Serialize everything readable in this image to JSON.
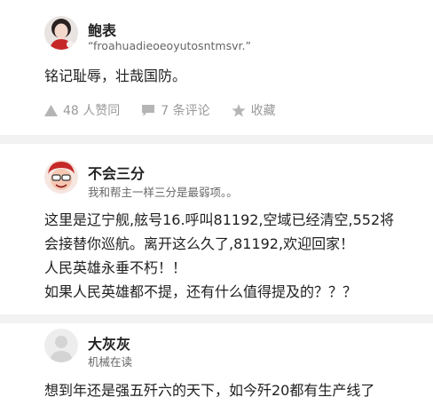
{
  "post": {
    "user": {
      "name": "鲍表",
      "subtitle": "“froahuadieoeoyutosntmsvr.”"
    },
    "text": "铭记耻辱，壮哉国防。",
    "actions": {
      "likes": "48 人赞同",
      "comments": "7 条评论",
      "favorite": "收藏"
    }
  },
  "comments": [
    {
      "name": "不会三分",
      "subtitle": "我和帮主一样三分是最弱项。。",
      "lines": [
        "这里是辽宁舰,舷号16.呼叫81192,空域已经清空,552将",
        "会接替你巡航。离开这么久了,81192,欢迎回家！",
        "人民英雄永垂不朽！！",
        "如果人民英雄都不提，还有什么值得提及的？？？"
      ]
    },
    {
      "name": "大灰灰",
      "subtitle": "机械在读",
      "lines": [
        "想到年还是强五歼六的天下，如今歼20都有生产线了"
      ]
    }
  ],
  "colors": {
    "text": "#1a1a1a",
    "muted": "#9a9a9a",
    "separator": "#f2f2f2"
  }
}
